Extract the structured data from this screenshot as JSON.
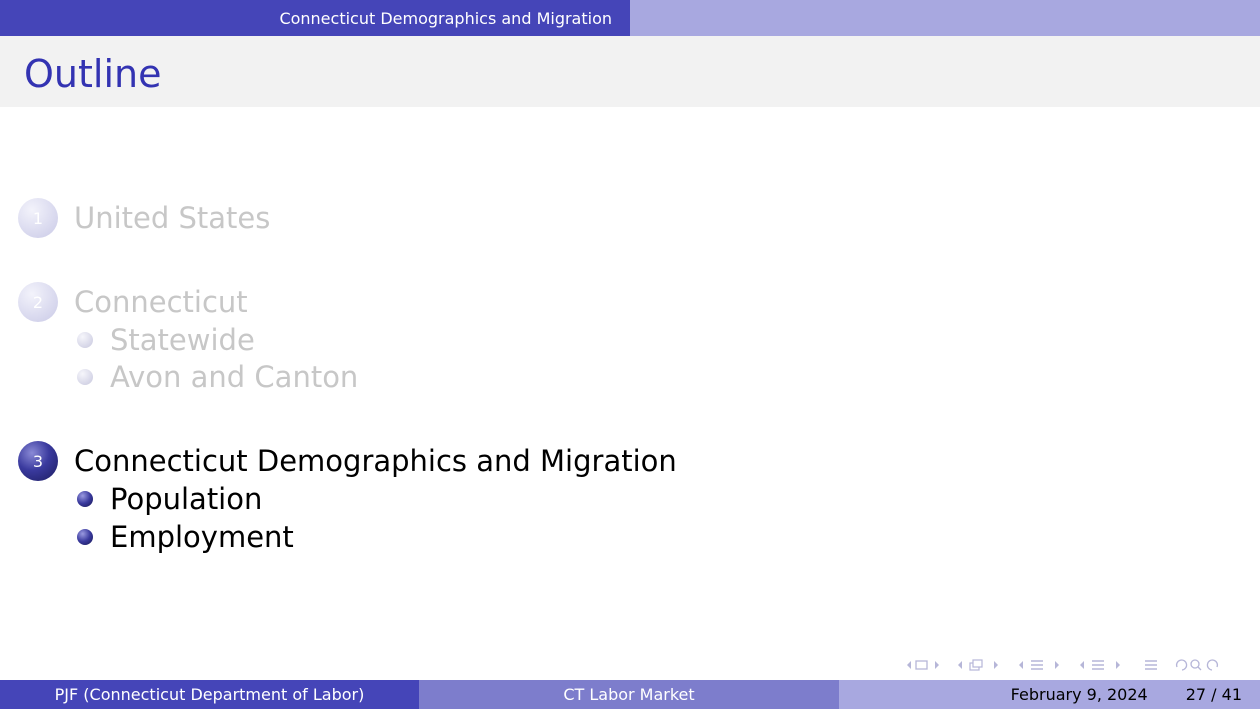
{
  "header": {
    "section_title": "Connecticut Demographics and Migration"
  },
  "frame": {
    "title": "Outline"
  },
  "toc": {
    "sections": [
      {
        "number": "1",
        "label": "United States",
        "state": "dim",
        "subsections": []
      },
      {
        "number": "2",
        "label": "Connecticut",
        "state": "dim",
        "subsections": [
          "Statewide",
          "Avon and Canton"
        ]
      },
      {
        "number": "3",
        "label": "Connecticut Demographics and Migration",
        "state": "active",
        "subsections": [
          "Population",
          "Employment"
        ]
      }
    ]
  },
  "footer": {
    "author": "PJF (Connecticut Department of Labor)",
    "short_title": "CT Labor Market",
    "date": "February 9, 2024",
    "page": "27 / 41"
  },
  "nav_icons": [
    "frame-nav-icon",
    "subsection-nav-icon",
    "section-nav-icon",
    "presentation-nav-icon",
    "outline-icon",
    "search-icon"
  ],
  "colors": {
    "accent": "#3333b2",
    "header_dark": "#4545b8",
    "header_light": "#a8a8e0",
    "footer_mid": "#7d7dcc"
  }
}
